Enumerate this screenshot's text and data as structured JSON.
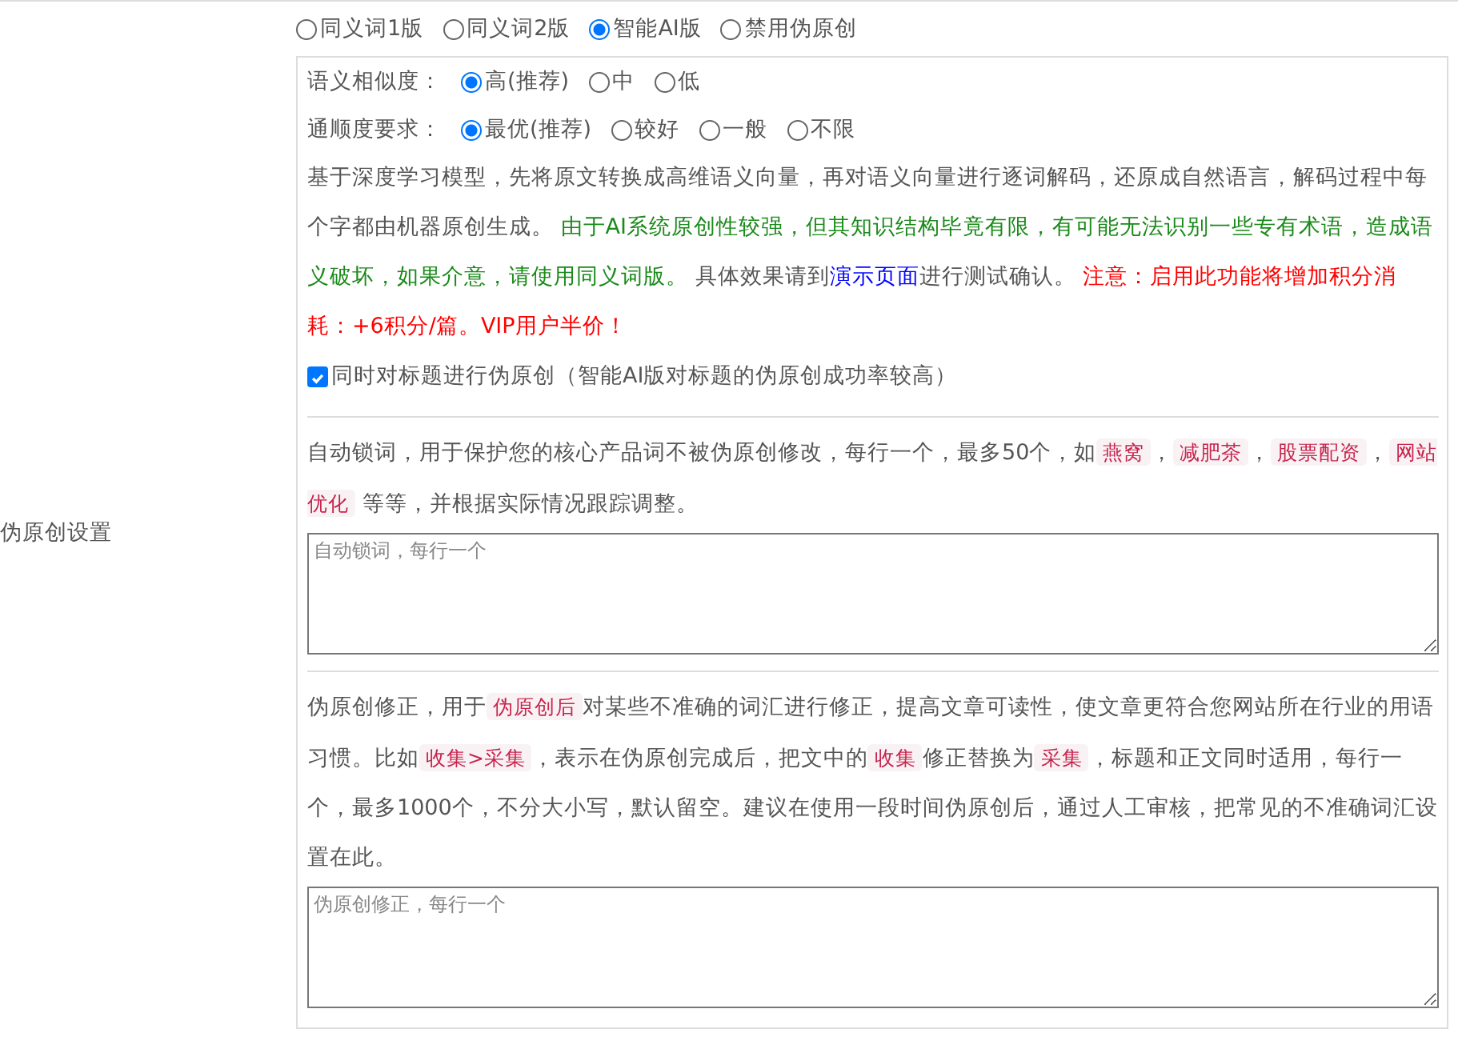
{
  "row_label": "伪原创设置",
  "mode_options": [
    {
      "label": "同义词1版",
      "selected": false
    },
    {
      "label": "同义词2版",
      "selected": false
    },
    {
      "label": "智能AI版",
      "selected": true
    },
    {
      "label": "禁用伪原创",
      "selected": false
    }
  ],
  "ai_panel": {
    "settings": [
      {
        "label": "语义相似度：",
        "options": [
          {
            "label": "高(推荐)",
            "selected": true
          },
          {
            "label": "中",
            "selected": false
          },
          {
            "label": "低",
            "selected": false
          }
        ]
      },
      {
        "label": "通顺度要求：",
        "options": [
          {
            "label": "最优(推荐)",
            "selected": true
          },
          {
            "label": "较好",
            "selected": false
          },
          {
            "label": "一般",
            "selected": false
          },
          {
            "label": "不限",
            "selected": false
          }
        ]
      }
    ],
    "description": [
      {
        "kind": "plain",
        "text": "基于深度学习模型，先将原文转换成高维语义向量，再对语义向量进行逐词解码，还原成自然语言，解码过程中每个字都由机器原创生成。 "
      },
      {
        "kind": "green",
        "text": "由于AI系统原创性较强，但其知识结构毕竟有限，有可能无法识别一些专有术语，造成语义破坏，如果介意，请使用同义词版。"
      },
      {
        "kind": "plain",
        "text": " 具体效果请到"
      },
      {
        "kind": "link",
        "text": "演示页面"
      },
      {
        "kind": "plain",
        "text": "进行测试确认。 "
      },
      {
        "kind": "red",
        "text": "注意：启用此功能将增加积分消耗：+6积分/篇。VIP用户半价！"
      }
    ],
    "title_checkbox": {
      "label": "同时对标题进行伪原创（智能AI版对标题的伪原创成功率较高）",
      "checked": true
    }
  },
  "lock": {
    "description": [
      {
        "kind": "plain",
        "text": "自动锁词，用于保护您的核心产品词不被伪原创修改，每行一个，最多50个，如"
      },
      {
        "kind": "code",
        "text": "燕窝"
      },
      {
        "kind": "plain",
        "text": "，"
      },
      {
        "kind": "code",
        "text": "减肥茶"
      },
      {
        "kind": "plain",
        "text": "，"
      },
      {
        "kind": "code",
        "text": "股票配资"
      },
      {
        "kind": "plain",
        "text": "，"
      },
      {
        "kind": "code",
        "text": "网站优化"
      },
      {
        "kind": "plain",
        "text": " 等等，并根据实际情况跟踪调整。"
      }
    ],
    "placeholder": "自动锁词，每行一个"
  },
  "correction": {
    "description": [
      {
        "kind": "plain",
        "text": "伪原创修正，用于"
      },
      {
        "kind": "code",
        "text": "伪原创后"
      },
      {
        "kind": "plain",
        "text": "对某些不准确的词汇进行修正，提高文章可读性，使文章更符合您网站所在行业的用语习惯。比如"
      },
      {
        "kind": "code",
        "text": "收集>采集"
      },
      {
        "kind": "plain",
        "text": "，表示在伪原创完成后，把文中的"
      },
      {
        "kind": "code",
        "text": "收集"
      },
      {
        "kind": "plain",
        "text": "修正替换为"
      },
      {
        "kind": "code",
        "text": "采集"
      },
      {
        "kind": "plain",
        "text": "，标题和正文同时适用，每行一个，最多1000个，不分大小写，默认留空。建议在使用一段时间伪原创后，通过人工审核，把常见的不准确词汇设置在此。"
      }
    ],
    "placeholder": "伪原创修正，每行一个"
  }
}
